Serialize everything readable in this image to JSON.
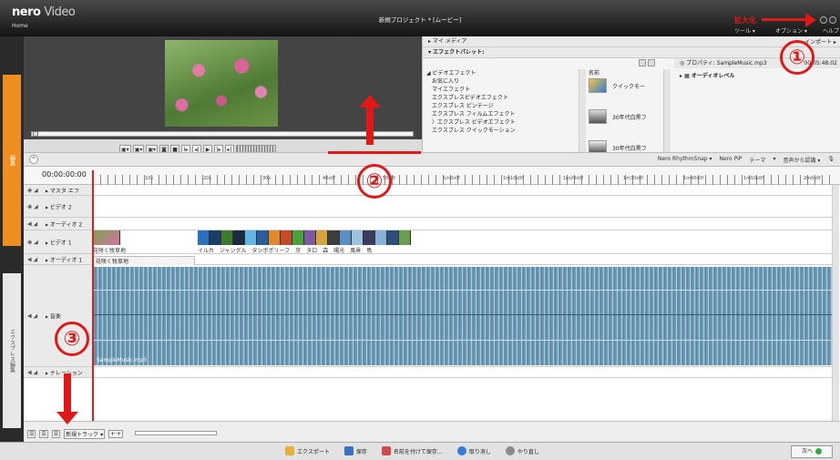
{
  "app": {
    "logo_brand": "nero",
    "logo_product": "Video",
    "home_label": "Home",
    "window_title": "新規プロジェクト * [ムービー]",
    "menu_tools": "ツール ▾",
    "menu_options": "オプション ▾",
    "menu_help": "ヘルプ"
  },
  "left_tabs": {
    "active": "編集",
    "other": "エクスプレス編集"
  },
  "preview": {
    "controls": [
      "▣▾",
      "▣▾",
      "▣▾",
      "◙",
      "■",
      "I▸",
      "◂|",
      "▶",
      "|▸",
      "▸|"
    ]
  },
  "right_panel": {
    "my_media": "▸ マイ メディア",
    "effects_palette": "▾ エフェクトパレット:",
    "effects": {
      "section": "◢ ビデオエフェクト",
      "items": [
        "お気に入り",
        "マイエフェクト",
        "エクスプレスビデオエフェクト",
        "エクスプレス ピンテージ",
        "エクスプレス フィルムエフェクト",
        "〉エクスプレス ビデオエフェクト",
        "エクスプレス クイックモーション"
      ]
    },
    "name_header": "名前",
    "thumbnails": [
      "クイックモー",
      "30年代白黒フ",
      "30年代白黒フ"
    ],
    "property_title": "◎ プロパティ: SampleMusic.mp3",
    "property_time": "00:05:48:02",
    "audio_level": "▸ ▦ オーディオレベル",
    "import_label": "インポート ▸"
  },
  "toolstrip": {
    "items": [
      "Nero RhythmSnap ▾",
      "Nero PiP",
      "テーマ",
      "▾",
      "音声から認識 ▾"
    ]
  },
  "timeline": {
    "timecode": "00:00:00:00",
    "ticks": [
      "10s",
      "20s",
      "30s",
      "40s0f",
      "50s0f",
      "1m0s0f",
      "1m10s0f",
      "1m20s0f",
      "1m30s0f",
      "1m40s0f",
      "1m50s0f",
      "2m0s0f"
    ],
    "tracks": [
      {
        "name": "▸ マスタ エフ"
      },
      {
        "name": "▸ ビデオ 2"
      },
      {
        "name": "▸ オーディオ 2"
      },
      {
        "name": "▸ ビデオ 1"
      },
      {
        "name": "▸ オーディオ 1"
      },
      {
        "name": "▸ 音楽"
      },
      {
        "name": "▸ ナレーション"
      }
    ],
    "clip_names": [
      "花咲く牧草地",
      "イルカ",
      "ジャングル",
      "タンポポリーフ",
      "牙",
      "タロ",
      "森",
      "陽光",
      "風景",
      "鳥"
    ],
    "audio1_clip": "花咲く牧草地",
    "music_clip": "SampleMusic.mp3",
    "footer_label": "新規トラック ▾"
  },
  "bottom_bar": {
    "export": "エクスポート",
    "save": "保存",
    "save_as": "名前を付けて保存…",
    "undo": "取り消し",
    "redo": "やり直し",
    "next": "次へ"
  },
  "annotations": {
    "zoom_label": "拡大化",
    "n1": "①",
    "n2": "②",
    "n3": "③"
  },
  "colors": {
    "accent_orange": "#ef8d1e",
    "annotation_red": "#e01818",
    "waveform": "#6c9ab5"
  }
}
